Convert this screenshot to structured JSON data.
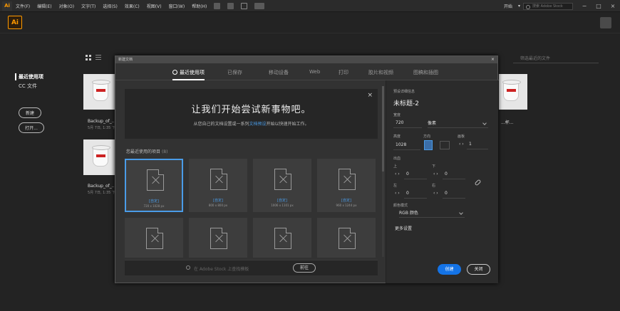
{
  "menubar": {
    "items": [
      "文件(F)",
      "编辑(E)",
      "对象(O)",
      "文字(T)",
      "选择(S)",
      "效果(C)",
      "视图(V)",
      "窗口(W)",
      "帮助(H)"
    ],
    "workspace": "开始",
    "search_placeholder": "搜索 Adobe Stock",
    "logo": "Ai"
  },
  "window_controls": [
    "−",
    "□",
    "×"
  ],
  "app_logo": "Ai",
  "sidebar": {
    "recent": "最近使用项",
    "cc_files": "CC 文件",
    "new_label": "新建",
    "open_label": "打开..."
  },
  "background": {
    "search_placeholder": "筛选最近的文件",
    "thumbs": [
      {
        "name": "Backup_of_...",
        "date": "5月 7日, 1:35 下午"
      },
      {
        "name": "Backup_of_...",
        "date": "5月 7日, 1:35 下午"
      },
      {
        "name": "...杯...",
        "date": ""
      }
    ]
  },
  "dialog": {
    "title": "新建文档",
    "close": "×",
    "tabs": [
      "最近使用项",
      "已保存",
      "移动设备",
      "Web",
      "打印",
      "胶片和视频",
      "图稿和插图"
    ],
    "banner": {
      "heading": "让我们开始尝试新事物吧。",
      "text_before": "从您自己的文档设置或一系列",
      "link": "文档预设",
      "text_after": "开始以快速开始工作。",
      "close": "×"
    },
    "recent_heading": "您最近使用的项目",
    "recent_count": "(8)",
    "cards": [
      {
        "name": "[自定]",
        "size": "720 x 1028 px"
      },
      {
        "name": "[自定]",
        "size": "800 x 800 px"
      },
      {
        "name": "[自定]",
        "size": "1006 x 1101 px"
      },
      {
        "name": "[自定]",
        "size": "960 x 1244 px"
      },
      {
        "name": "",
        "size": ""
      },
      {
        "name": "",
        "size": ""
      },
      {
        "name": "",
        "size": ""
      },
      {
        "name": "",
        "size": ""
      }
    ],
    "stock_placeholder": "在 Adobe Stock 上查找模板",
    "stock_go": "前往",
    "details": {
      "heading": "预设详细信息",
      "doc_name": "未标题-2",
      "width_label": "宽度",
      "width_value": "720",
      "unit": "像素",
      "height_label": "高度",
      "height_value": "1028",
      "orientation_label": "方向",
      "artboards_label": "画板",
      "artboards_value": "1",
      "bleed_label": "出血",
      "top_label": "上",
      "top_value": "0",
      "bottom_label": "下",
      "bottom_value": "0",
      "left_label": "左",
      "left_value": "0",
      "right_label": "右",
      "right_value": "0",
      "color_mode_label": "颜色模式",
      "color_mode_value": "RGB 颜色",
      "more_settings": "更多设置"
    },
    "create": "创建",
    "close_btn": "关闭"
  },
  "colors": {
    "accent": "#1473e6",
    "link": "#4a9ce8",
    "brand": "#ff9a00"
  }
}
